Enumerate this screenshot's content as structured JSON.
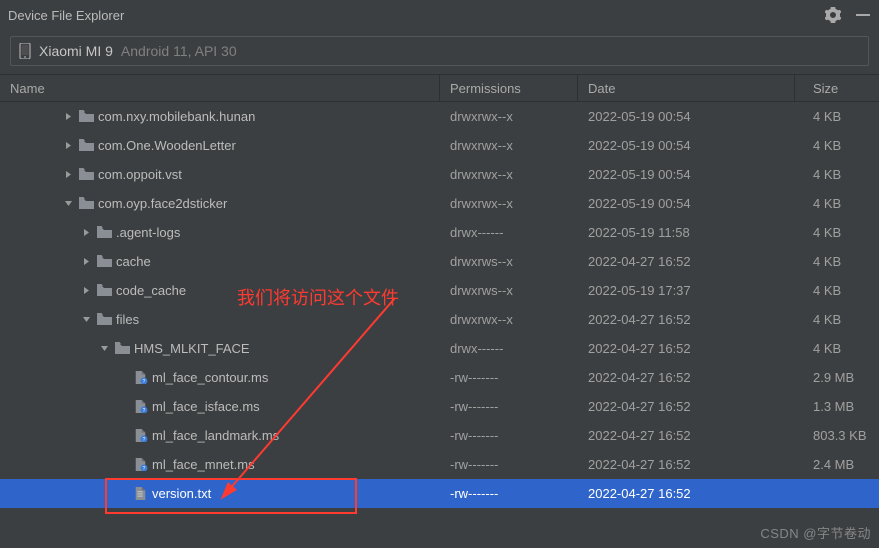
{
  "titlebar": {
    "title": "Device File Explorer"
  },
  "device": {
    "name": "Xiaomi MI 9",
    "sub": "Android 11, API 30"
  },
  "columns": {
    "name": "Name",
    "perm": "Permissions",
    "date": "Date",
    "size": "Size"
  },
  "rows": [
    {
      "indent": 3,
      "toggle": "right",
      "icon": "folder",
      "label": "com.nxy.mobilebank.hunan",
      "perm": "drwxrwx--x",
      "date": "2022-05-19 00:54",
      "size": "4 KB",
      "selected": false
    },
    {
      "indent": 3,
      "toggle": "right",
      "icon": "folder",
      "label": "com.One.WoodenLetter",
      "perm": "drwxrwx--x",
      "date": "2022-05-19 00:54",
      "size": "4 KB",
      "selected": false
    },
    {
      "indent": 3,
      "toggle": "right",
      "icon": "folder",
      "label": "com.oppoit.vst",
      "perm": "drwxrwx--x",
      "date": "2022-05-19 00:54",
      "size": "4 KB",
      "selected": false
    },
    {
      "indent": 3,
      "toggle": "down",
      "icon": "folder",
      "label": "com.oyp.face2dsticker",
      "perm": "drwxrwx--x",
      "date": "2022-05-19 00:54",
      "size": "4 KB",
      "selected": false
    },
    {
      "indent": 4,
      "toggle": "right",
      "icon": "folder",
      "label": ".agent-logs",
      "perm": "drwx------",
      "date": "2022-05-19 11:58",
      "size": "4 KB",
      "selected": false
    },
    {
      "indent": 4,
      "toggle": "right",
      "icon": "folder",
      "label": "cache",
      "perm": "drwxrws--x",
      "date": "2022-04-27 16:52",
      "size": "4 KB",
      "selected": false
    },
    {
      "indent": 4,
      "toggle": "right",
      "icon": "folder",
      "label": "code_cache",
      "perm": "drwxrws--x",
      "date": "2022-05-19 17:37",
      "size": "4 KB",
      "selected": false
    },
    {
      "indent": 4,
      "toggle": "down",
      "icon": "folder",
      "label": "files",
      "perm": "drwxrwx--x",
      "date": "2022-04-27 16:52",
      "size": "4 KB",
      "selected": false
    },
    {
      "indent": 5,
      "toggle": "down",
      "icon": "folder",
      "label": "HMS_MLKIT_FACE",
      "perm": "drwx------",
      "date": "2022-04-27 16:52",
      "size": "4 KB",
      "selected": false
    },
    {
      "indent": 6,
      "toggle": "none",
      "icon": "file-q",
      "label": "ml_face_contour.ms",
      "perm": "-rw-------",
      "date": "2022-04-27 16:52",
      "size": "2.9 MB",
      "selected": false
    },
    {
      "indent": 6,
      "toggle": "none",
      "icon": "file-q",
      "label": "ml_face_isface.ms",
      "perm": "-rw-------",
      "date": "2022-04-27 16:52",
      "size": "1.3 MB",
      "selected": false
    },
    {
      "indent": 6,
      "toggle": "none",
      "icon": "file-q",
      "label": "ml_face_landmark.ms",
      "perm": "-rw-------",
      "date": "2022-04-27 16:52",
      "size": "803.3 KB",
      "selected": false
    },
    {
      "indent": 6,
      "toggle": "none",
      "icon": "file-q",
      "label": "ml_face_mnet.ms",
      "perm": "-rw-------",
      "date": "2022-04-27 16:52",
      "size": "2.4 MB",
      "selected": false
    },
    {
      "indent": 6,
      "toggle": "none",
      "icon": "file",
      "label": "version.txt",
      "perm": "-rw-------",
      "date": "2022-04-27 16:52",
      "size": "",
      "selected": true
    }
  ],
  "annotation": {
    "text": "我们将访问这个文件"
  },
  "watermark": "CSDN @字节卷动"
}
